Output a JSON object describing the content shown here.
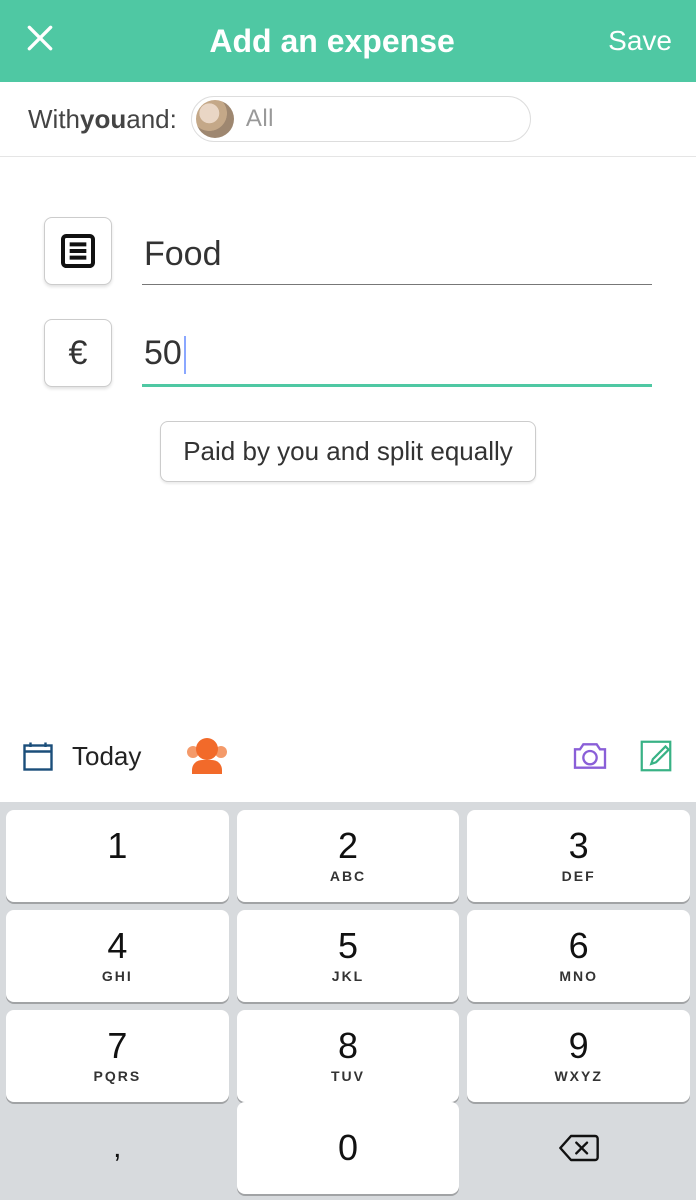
{
  "header": {
    "title": "Add an expense",
    "save": "Save"
  },
  "with": {
    "prefix": "With ",
    "you": "you",
    "and": " and:",
    "chip_text": "All"
  },
  "expense": {
    "description": "Food",
    "currency_symbol": "€",
    "amount": "50",
    "split_label": "Paid by you and split equally"
  },
  "toolbar": {
    "date": "Today"
  },
  "keypad": {
    "rows": [
      [
        {
          "n": "1",
          "l": ""
        },
        {
          "n": "2",
          "l": "ABC"
        },
        {
          "n": "3",
          "l": "DEF"
        }
      ],
      [
        {
          "n": "4",
          "l": "GHI"
        },
        {
          "n": "5",
          "l": "JKL"
        },
        {
          "n": "6",
          "l": "MNO"
        }
      ],
      [
        {
          "n": "7",
          "l": "PQRS"
        },
        {
          "n": "8",
          "l": "TUV"
        },
        {
          "n": "9",
          "l": "WXYZ"
        }
      ]
    ],
    "comma": ",",
    "zero": "0"
  }
}
